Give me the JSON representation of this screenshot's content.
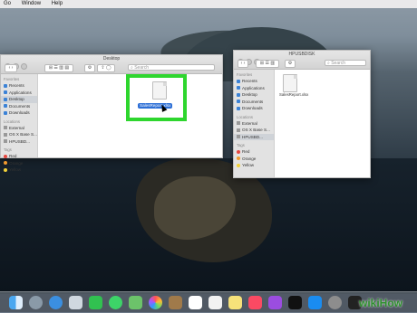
{
  "menubar": {
    "items": [
      "Go",
      "Window",
      "Help"
    ]
  },
  "finder_left": {
    "title": "Desktop",
    "search_placeholder": "Search",
    "sidebar": {
      "favorites_header": "Favorites",
      "favorites": [
        "Recents",
        "Applications",
        "Desktop",
        "Documents",
        "Downloads"
      ],
      "locations_header": "Locations",
      "locations": [
        "External",
        "OS X Base S...",
        "HPUSBD..."
      ],
      "tags_header": "Tags",
      "tags": [
        {
          "label": "Red",
          "color": "#e5463f"
        },
        {
          "label": "Orange",
          "color": "#f29a2e"
        },
        {
          "label": "Yellow",
          "color": "#f3d23a"
        }
      ]
    },
    "file": {
      "name": "SalesReport.xlsx"
    }
  },
  "finder_right": {
    "title": "HPUSBDISK",
    "search_placeholder": "Search",
    "sidebar": {
      "favorites_header": "Favorites",
      "favorites": [
        "Recents",
        "Applications",
        "Desktop",
        "Documents",
        "Downloads"
      ],
      "locations_header": "Locations",
      "locations": [
        "External",
        "OS X Base S...",
        "HPUSBD..."
      ],
      "tags_header": "Tags",
      "tags": [
        {
          "label": "Red",
          "color": "#e5463f"
        },
        {
          "label": "Orange",
          "color": "#f29a2e"
        },
        {
          "label": "Yellow",
          "color": "#f3d23a"
        }
      ]
    },
    "file": {
      "name": "SalesReport.xlsx"
    }
  },
  "highlight_color": "#2ed62e",
  "dock": {
    "apps": [
      "finder",
      "launchpad",
      "safari",
      "photos",
      "facetime",
      "messages",
      "maps",
      "photos-app",
      "notes",
      "calendar",
      "reminders",
      "stickies",
      "music",
      "podcasts",
      "tv",
      "appstore",
      "settings",
      "terminal"
    ]
  },
  "watermark": "wikiHow"
}
